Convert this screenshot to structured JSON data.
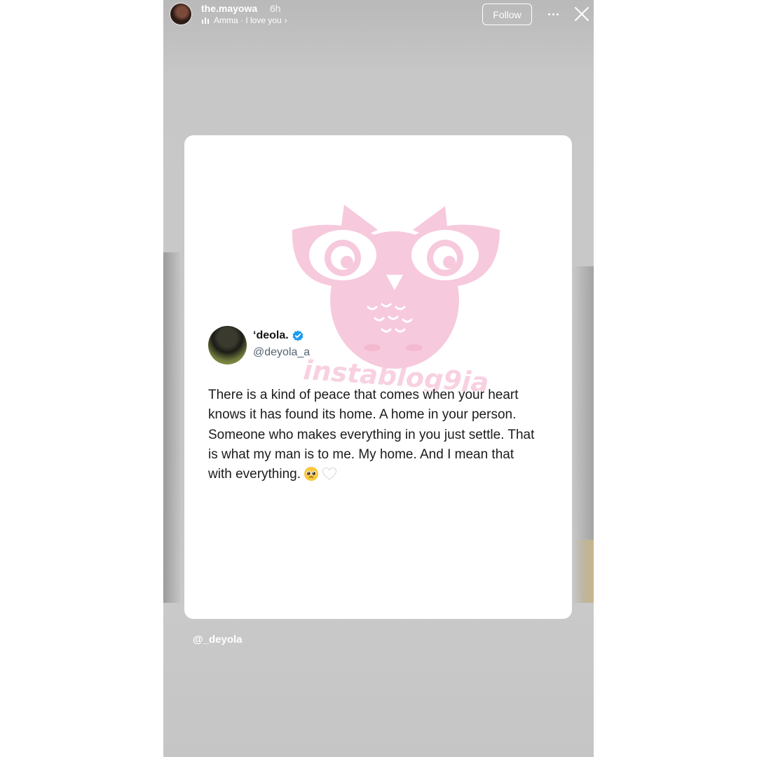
{
  "story": {
    "username": "the.mayowa",
    "time_ago": "6h",
    "music": "Amma · I love you",
    "music_chevron": "›",
    "follow_label": "Follow"
  },
  "post": {
    "author_name": "‘deola.",
    "author_handle": "@deyola_a",
    "text": "There is a kind of peace that comes when your heart knows it has found its home. A home in your person. Someone who makes everything in you just settle. That is what my man is to me. My home. And I mean that with everything.",
    "watermark": "instablog9ja"
  },
  "credit": "@_deyola",
  "colors": {
    "story_bg": "#c8c8c8",
    "watermark_pink": "#f6c6da",
    "verified_blue": "#1d9bf0",
    "handle_grey": "#536471"
  },
  "icons": {
    "close": "close-icon",
    "more": "more-icon",
    "verified": "verified-badge-icon",
    "music": "music-bars-icon"
  }
}
